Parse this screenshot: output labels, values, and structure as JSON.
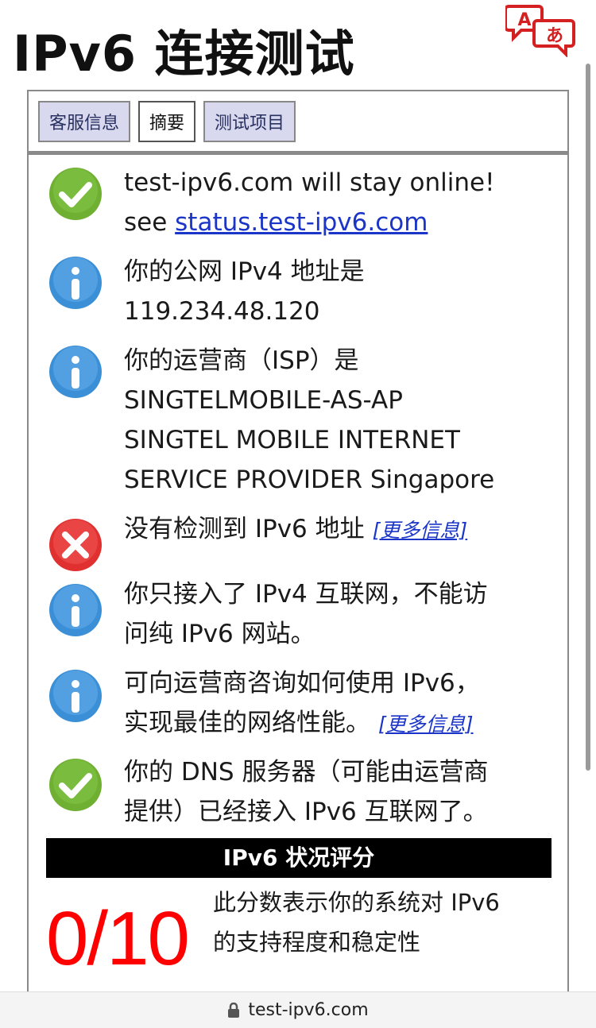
{
  "page": {
    "title": "IPv6 连接测试"
  },
  "tabs": [
    {
      "label": "客服信息",
      "active": false
    },
    {
      "label": "摘要",
      "active": true
    },
    {
      "label": "测试项目",
      "active": false
    }
  ],
  "rows": [
    {
      "icon": "check-icon",
      "text_before": "test-ipv6.com will stay online!",
      "text_line2_prefix": "see ",
      "link": "status.test-ipv6.com"
    },
    {
      "icon": "info-icon",
      "line1": "你的公网 IPv4 地址是",
      "line2": "119.234.48.120"
    },
    {
      "icon": "info-icon",
      "line1": "你的运营商（ISP）是",
      "line2": "SINGTELMOBILE-AS-AP",
      "line3": "SINGTEL MOBILE INTERNET",
      "line4": "SERVICE PROVIDER Singapore"
    },
    {
      "icon": "error-icon",
      "line1": "没有检测到 IPv6 地址",
      "more": "[更多信息]"
    },
    {
      "icon": "info-icon",
      "line1": "你只接入了 IPv4 互联网，不能访",
      "line2": "问纯 IPv6 网站。"
    },
    {
      "icon": "info-icon",
      "line1": "可向运营商咨询如何使用 IPv6，",
      "line2": "实现最佳的网络性能。",
      "more": "[更多信息]"
    },
    {
      "icon": "check-icon",
      "line1": "你的 DNS 服务器（可能由运营商",
      "line2": "提供）已经接入 IPv6 互联网了。"
    }
  ],
  "score": {
    "header": "IPv6 状况评分",
    "value": "0/10",
    "desc_line1": "此分数表示你的系统对 IPv6",
    "desc_line2": "的支持程度和稳定性"
  },
  "browser": {
    "url": "test-ipv6.com"
  },
  "colors": {
    "check": "#6fb033",
    "info": "#3b8fd6",
    "error": "#e03030",
    "score": "#ff0000",
    "link": "#1a35c8"
  }
}
